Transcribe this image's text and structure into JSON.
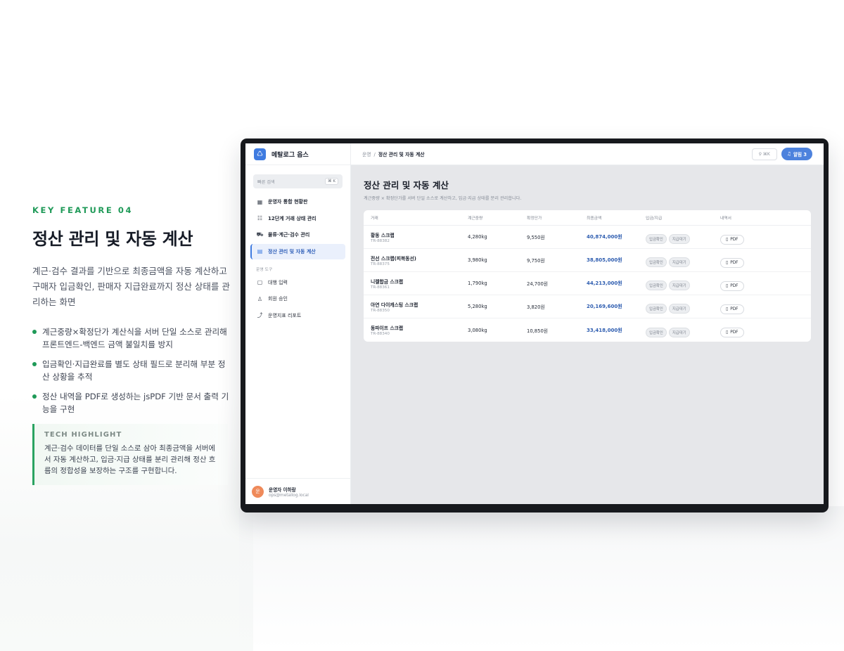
{
  "feature": {
    "eyebrow": "KEY FEATURE 04",
    "headline": "정산 관리 및 자동 계산",
    "description": "계근·검수 결과를 기반으로 최종금액을 자동 계산하고 구매자 입금확인, 판매자 지급완료까지 정산 상태를 관리하는 화면",
    "bullets": [
      "계근중량×확정단가 계산식을 서버 단일 소스로 관리해 프론트엔드-백엔드 금액 불일치를 방지",
      "입금확인·지급완료를 별도 상태 필드로 분리해 부분 정산 상황을 추적",
      "정산 내역을 PDF로 생성하는 jsPDF 기반 문서 출력 기능을 구현"
    ],
    "highlight_title": "TECH HIGHLIGHT",
    "highlight_body": "계근·검수 데이터를 단일 소스로 삼아 최종금액을 서버에서 자동 계산하고, 입금·지급 상태를 분리 관리해 정산 흐름의 정합성을 보장하는 구조를 구현합니다."
  },
  "app": {
    "brand": "메탈로그 옵스",
    "quick_search_placeholder": "빠른 검색",
    "quick_search_kbd": "⌘ K",
    "nav": [
      {
        "label": "운영자 통합 현황판",
        "icon": "grid-icon",
        "glyph": "▦"
      },
      {
        "label": "12단계 거래 상태 관리",
        "icon": "kanban-icon",
        "glyph": "☷"
      },
      {
        "label": "물류·계근·검수 관리",
        "icon": "truck-icon",
        "glyph": "⛟"
      },
      {
        "label": "정산 관리 및 자동 계산",
        "icon": "calculator-icon",
        "glyph": "▤",
        "active": true
      }
    ],
    "tools_section": "운영 도구",
    "tools": [
      {
        "label": "대행 입력",
        "icon": "clipboard-icon",
        "glyph": "▢"
      },
      {
        "label": "회원 승인",
        "icon": "user-check-icon",
        "glyph": "♙"
      },
      {
        "label": "운영지표 리포트",
        "icon": "chart-icon",
        "glyph": "⤴"
      }
    ],
    "user": {
      "avatar": "운",
      "name": "운영자 이하랑",
      "email": "ops@metallog.local"
    },
    "breadcrumb": {
      "root": "운영",
      "sep": "/",
      "current": "정산 관리 및 자동 계산"
    },
    "search_shortcut": "⌘K",
    "alert_label": "알림 3",
    "page_title": "정산 관리 및 자동 계산",
    "page_subtitle": "계근중량 × 확정단가를 서버 단일 소스로 계산하고, 입금·지급 상태를 분리 관리합니다.",
    "columns": [
      "거래",
      "계근중량",
      "확정단가",
      "최종금액",
      "입금/지급",
      "내역서"
    ],
    "rows": [
      {
        "name": "황동 스크랩",
        "id": "TR-88382",
        "weight": "4,280kg",
        "price": "9,550원",
        "amount": "40,874,000원",
        "tag1": "입금확인",
        "tag2": "지급대기",
        "pdf": "PDF"
      },
      {
        "name": "전선 스크랩(피복동선)",
        "id": "TR-88375",
        "weight": "3,980kg",
        "price": "9,750원",
        "amount": "38,805,000원",
        "tag1": "입금확인",
        "tag2": "지급대기",
        "pdf": "PDF"
      },
      {
        "name": "니켈합금 스크랩",
        "id": "TR-88361",
        "weight": "1,790kg",
        "price": "24,700원",
        "amount": "44,213,000원",
        "tag1": "입금확인",
        "tag2": "지급대기",
        "pdf": "PDF"
      },
      {
        "name": "아연 다이캐스팅 스크랩",
        "id": "TR-88350",
        "weight": "5,280kg",
        "price": "3,820원",
        "amount": "20,169,600원",
        "tag1": "입금확인",
        "tag2": "지급대기",
        "pdf": "PDF"
      },
      {
        "name": "동파이프 스크랩",
        "id": "TR-88340",
        "weight": "3,080kg",
        "price": "10,850원",
        "amount": "33,418,000원",
        "tag1": "입금확인",
        "tag2": "지급대기",
        "pdf": "PDF"
      }
    ]
  },
  "colors": {
    "accent_green": "#1f9a58",
    "accent_blue": "#3f7be0",
    "amount_blue": "#2e5db0"
  }
}
